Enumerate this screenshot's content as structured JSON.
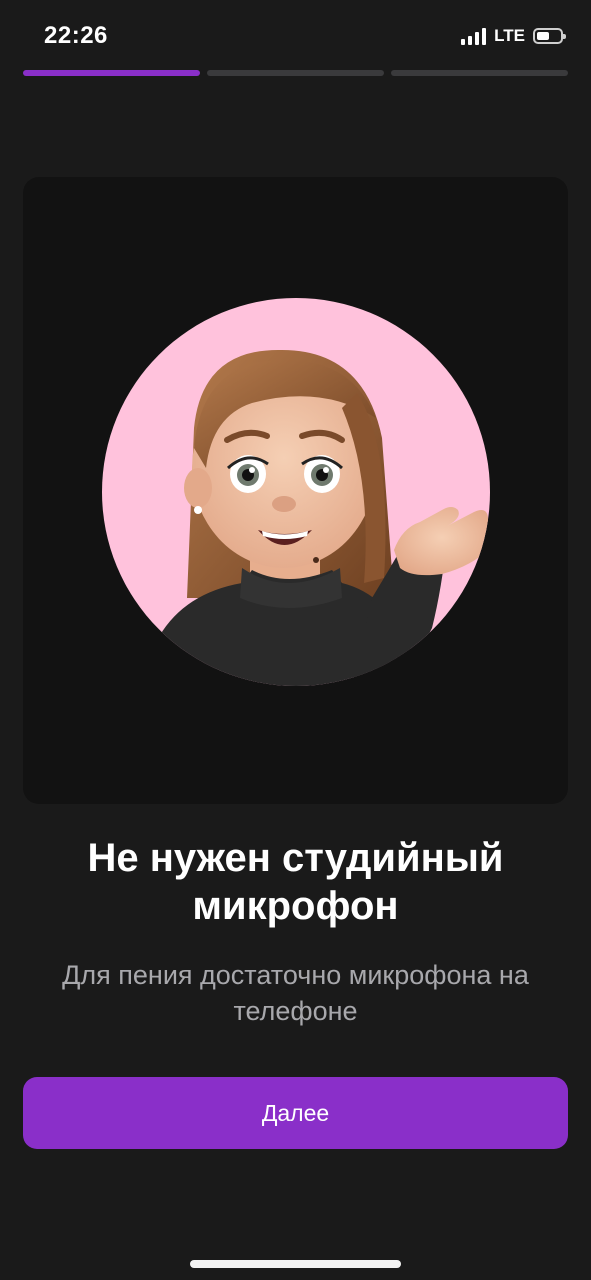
{
  "status_bar": {
    "time": "22:26",
    "network": "LTE",
    "signal_bars": 4,
    "battery_level": 0.55
  },
  "onboarding": {
    "step": 1,
    "total_steps": 3
  },
  "illustration": {
    "icon": "memoji-avatar-waving",
    "background_color": "#ffc2dc"
  },
  "content": {
    "title": "Не нужен студийный микрофон",
    "subtitle": "Для пения достаточно микрофона на телефоне"
  },
  "actions": {
    "next_label": "Далее"
  },
  "colors": {
    "accent": "#8a2fc9",
    "background": "#1a1a1a",
    "card": "#121212",
    "inactive_progress": "#3a3a3c"
  }
}
